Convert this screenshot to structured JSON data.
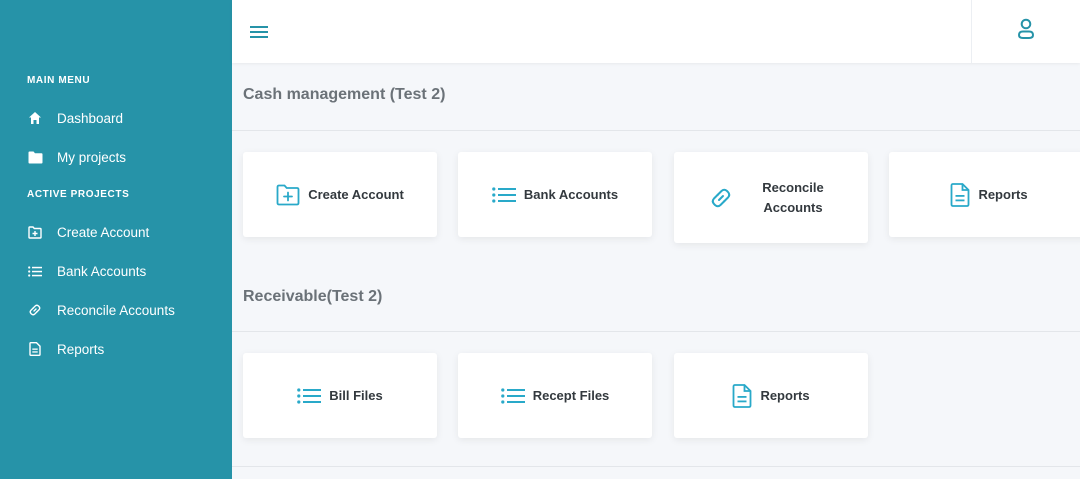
{
  "sidebar": {
    "sections": {
      "main_menu": "MAIN MENU",
      "active_projects": "ACTIVE PROJECTS"
    },
    "main_items": [
      {
        "label": "Dashboard",
        "icon": "home-icon"
      },
      {
        "label": "My projects",
        "icon": "folder-icon"
      }
    ],
    "project_items": [
      {
        "label": "Create Account",
        "icon": "folder-plus-icon"
      },
      {
        "label": "Bank Accounts",
        "icon": "list-icon"
      },
      {
        "label": "Reconcile Accounts",
        "icon": "link-icon"
      },
      {
        "label": "Reports",
        "icon": "document-icon"
      }
    ]
  },
  "topbar": {
    "menu_icon": "hamburger-icon",
    "user_icon": "user-icon"
  },
  "sections": [
    {
      "title": "Cash management (Test 2)",
      "cards": [
        {
          "label": "Create Account",
          "icon": "folder-plus-icon"
        },
        {
          "label": "Bank Accounts",
          "icon": "list-icon"
        },
        {
          "label_line1": "Reconcile",
          "label_line2": "Accounts",
          "icon": "link-icon"
        },
        {
          "label": "Reports",
          "icon": "document-icon"
        }
      ]
    },
    {
      "title": "Receivable(Test 2)",
      "cards": [
        {
          "label": "Bill Files",
          "icon": "list-icon"
        },
        {
          "label": "Recept Files",
          "icon": "list-icon"
        },
        {
          "label": "Reports",
          "icon": "document-icon"
        }
      ]
    }
  ],
  "colors": {
    "sidebar_bg": "#2693a8",
    "accent": "#29a9c9",
    "page_bg": "#f5f7fa"
  }
}
